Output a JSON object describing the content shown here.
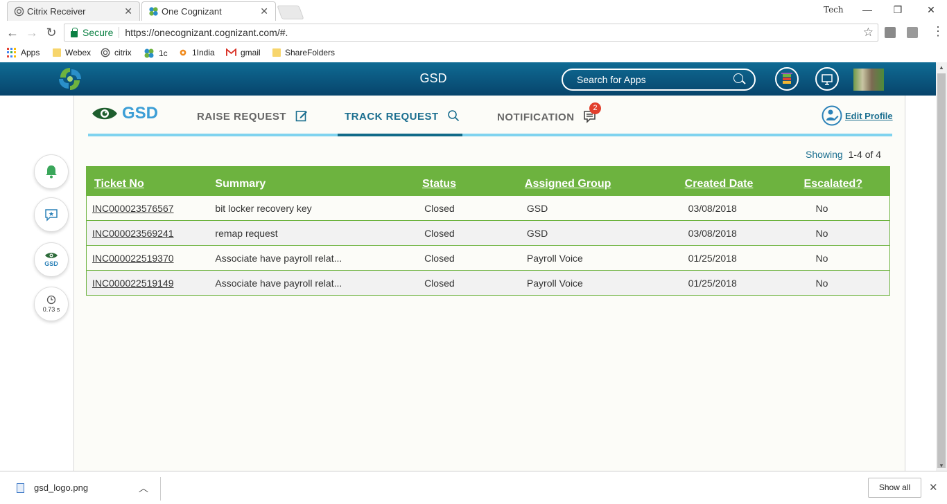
{
  "browser": {
    "tabs": [
      {
        "title": "Citrix Receiver",
        "close": "✕"
      },
      {
        "title": "One Cognizant",
        "close": "✕"
      }
    ],
    "window_user": "Tech",
    "window_controls": {
      "minimize": "—",
      "maximize": "❐",
      "close": "✕"
    },
    "security_label": "Secure",
    "url": "https://onecognizant.cognizant.com/#.",
    "bookmarks": [
      "Apps",
      "Webex",
      "citrix",
      "1c",
      "1India",
      "gmail",
      "ShareFolders"
    ]
  },
  "app_header": {
    "title": "GSD",
    "search_placeholder": "Search for Apps",
    "colors": {
      "header_bg": "#0a5a82",
      "accent_green": "#6db33f",
      "accent_blue": "#1a6e8f"
    }
  },
  "sidebar": {
    "gsd_label": "GSD",
    "timer": "0.73 s"
  },
  "nav": {
    "brand": "GSD",
    "raise_request": "RAISE REQUEST",
    "track_request": "TRACK REQUEST",
    "notification": "NOTIFICATION",
    "notification_count": "2",
    "edit_profile": "Edit Profile"
  },
  "results": {
    "showing_label": "Showing",
    "showing_range": "1-4 of 4"
  },
  "table": {
    "headers": [
      "Ticket No",
      "Summary",
      "Status",
      "Assigned Group",
      "Created Date",
      "Escalated?"
    ],
    "rows": [
      {
        "ticket": "INC000023576567",
        "summary": "bit locker recovery key",
        "status": "Closed",
        "group": "GSD",
        "created": "03/08/2018",
        "escalated": "No"
      },
      {
        "ticket": "INC000023569241",
        "summary": "remap request",
        "status": "Closed",
        "group": "GSD",
        "created": "03/08/2018",
        "escalated": "No"
      },
      {
        "ticket": "INC000022519370",
        "summary": "Associate have payroll relat...",
        "status": "Closed",
        "group": "Payroll Voice",
        "created": "01/25/2018",
        "escalated": "No"
      },
      {
        "ticket": "INC000022519149",
        "summary": "Associate have payroll relat...",
        "status": "Closed",
        "group": "Payroll Voice",
        "created": "01/25/2018",
        "escalated": "No"
      }
    ]
  },
  "downloads": {
    "file_name": "gsd_logo.png",
    "show_all": "Show all",
    "close": "✕"
  }
}
